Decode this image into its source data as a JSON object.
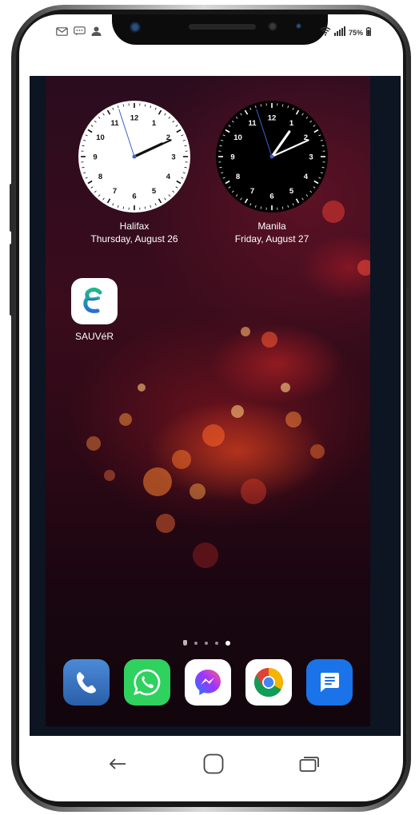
{
  "status_bar": {
    "left_icons": [
      "mail-icon",
      "message-icon",
      "person-icon"
    ],
    "right_icons": [
      "wifi-icon",
      "signal-icon",
      "battery-icon"
    ],
    "battery": "75%"
  },
  "clocks": [
    {
      "city": "Halifax",
      "date": "Thursday, August 26",
      "face": "white",
      "numbers": [
        "12",
        "1",
        "2",
        "3",
        "4",
        "5",
        "6",
        "7",
        "8",
        "9",
        "10",
        "11"
      ],
      "time": {
        "hour": 2,
        "minute": 10,
        "second": 57
      }
    },
    {
      "city": "Manila",
      "date": "Friday, August 27",
      "face": "black",
      "numbers": [
        "12",
        "1",
        "2",
        "3",
        "4",
        "5",
        "6",
        "7",
        "8",
        "9",
        "10",
        "11"
      ],
      "time": {
        "hour": 1,
        "minute": 10,
        "second": 57
      }
    }
  ],
  "home_app": {
    "label": "SAUVéR",
    "icon": "sauver-logo-icon"
  },
  "page_indicator": {
    "pages": 5,
    "current": 5
  },
  "dock": [
    {
      "name": "phone-app",
      "icon": "phone-icon",
      "color": "#2f73c7"
    },
    {
      "name": "whatsapp-app",
      "icon": "whatsapp-icon",
      "color": "#25d366"
    },
    {
      "name": "messenger-app",
      "icon": "messenger-icon",
      "color": "#ffffff"
    },
    {
      "name": "chrome-app",
      "icon": "chrome-icon",
      "color": "#ffffff"
    },
    {
      "name": "messages-app",
      "icon": "messages-icon",
      "color": "#1a73e8"
    }
  ],
  "nav_bar": {
    "buttons": [
      "back-icon",
      "home-icon",
      "recents-icon"
    ]
  }
}
